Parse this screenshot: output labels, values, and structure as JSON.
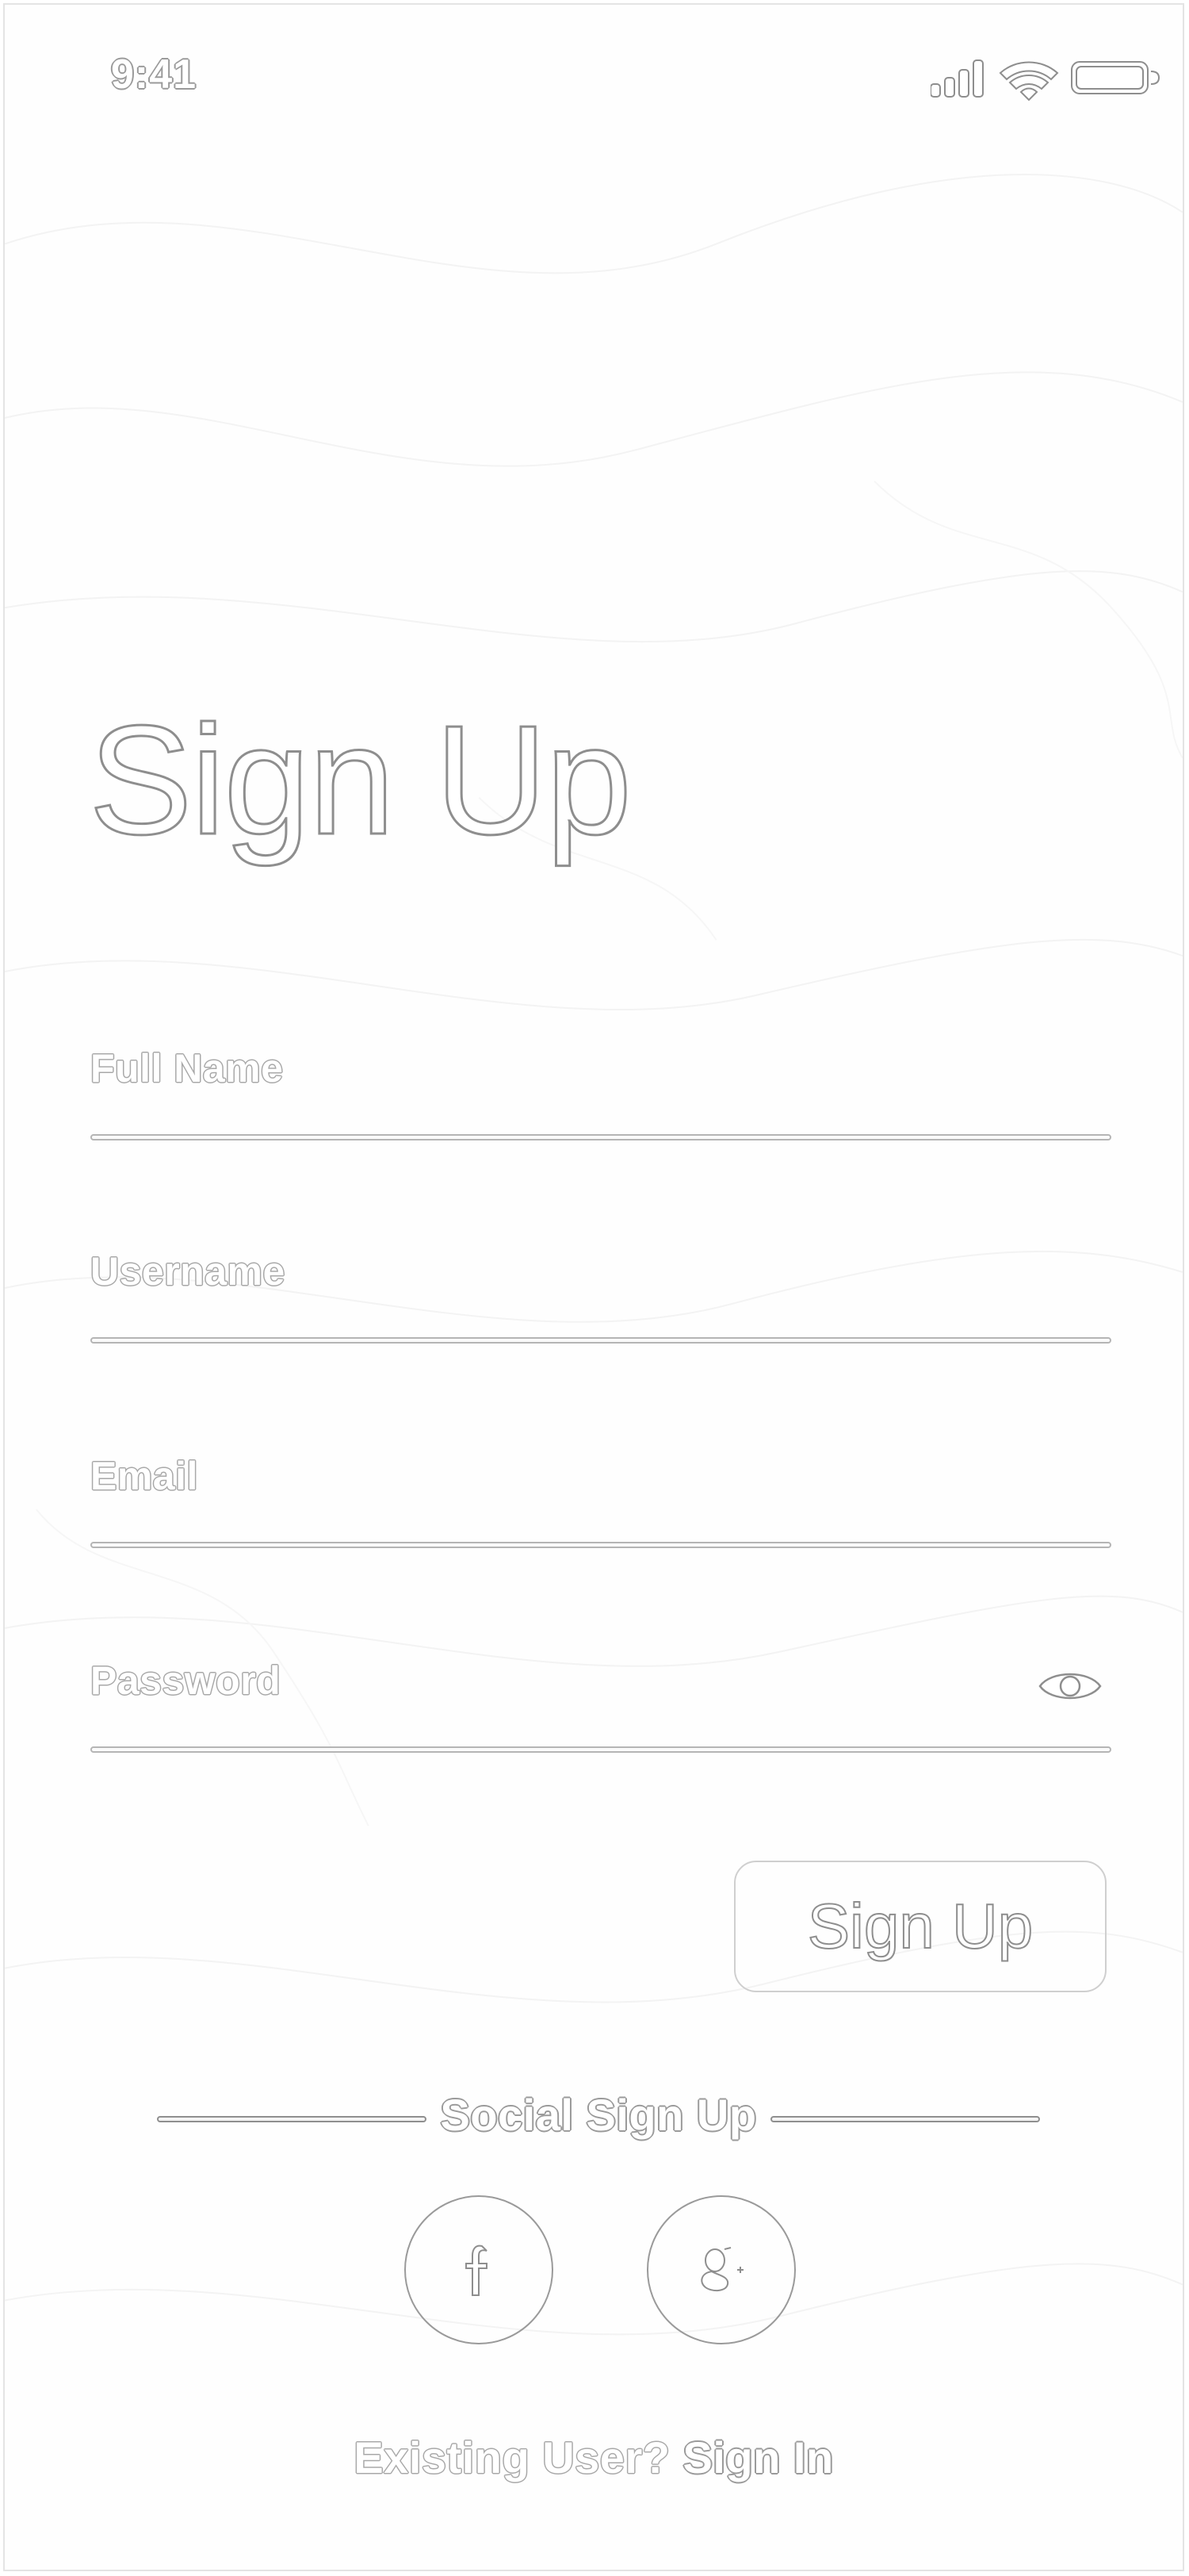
{
  "status_bar": {
    "time": "9:41"
  },
  "page": {
    "title": "Sign Up"
  },
  "form": {
    "full_name_placeholder": "Full Name",
    "username_placeholder": "Username",
    "email_placeholder": "Email",
    "password_placeholder": "Password",
    "submit_label": "Sign Up"
  },
  "social": {
    "divider_label": "Social Sign Up",
    "facebook_icon": "facebook-icon",
    "google_icon": "google-plus-icon"
  },
  "footer": {
    "existing_prompt": "Existing User?",
    "sign_in_label": "Sign In"
  },
  "icons": {
    "signal": "signal-icon",
    "wifi": "wifi-icon",
    "battery": "battery-icon",
    "password_toggle": "eye-icon"
  },
  "colors": {
    "outline": "#9a9a9a",
    "background": "#fefefe"
  }
}
